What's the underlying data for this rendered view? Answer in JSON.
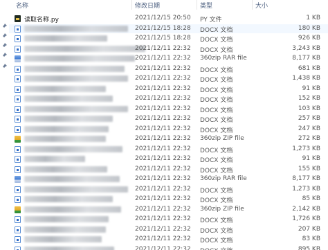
{
  "header": {
    "name": "名称",
    "date": "修改日期",
    "type": "类型",
    "size": "大小"
  },
  "files": [
    {
      "name": "读取名称.py",
      "date": "2021/12/15 20:50",
      "type": "PY 文件",
      "size": "1 KB",
      "icon": "python-file-icon"
    },
    {
      "name": "",
      "date": "2021/12/15 18:28",
      "type": "DOCX 文档",
      "size": "180 KB",
      "icon": "docx-file-icon"
    },
    {
      "name": "",
      "date": "2021/12/15 18:28",
      "type": "DOCX 文档",
      "size": "926 KB",
      "icon": "docx-file-icon"
    },
    {
      "name": "",
      "date": "2021/12/11 22:32",
      "type": "DOCX 文档",
      "size": "3,243 KB",
      "icon": "docx-file-icon"
    },
    {
      "name": "",
      "date": "2021/12/11 22:32",
      "type": "360zip RAR file",
      "size": "8,177 KB",
      "icon": "rar-archive-icon"
    },
    {
      "name": "",
      "date": "2021/12/11 22:32",
      "type": "DOCX 文档",
      "size": "681 KB",
      "icon": "docx-file-icon"
    },
    {
      "name": "",
      "date": "2021/12/11 22:32",
      "type": "DOCX 文档",
      "size": "1,438 KB",
      "icon": "docx-file-icon"
    },
    {
      "name": "",
      "date": "2021/12/11 22:32",
      "type": "DOCX 文档",
      "size": "91 KB",
      "icon": "docx-file-icon"
    },
    {
      "name": "",
      "date": "2021/12/11 22:32",
      "type": "DOCX 文档",
      "size": "152 KB",
      "icon": "docx-file-icon"
    },
    {
      "name": "",
      "date": "2021/12/11 22:32",
      "type": "DOCX 文档",
      "size": "103 KB",
      "icon": "docx-file-icon"
    },
    {
      "name": "",
      "date": "2021/12/11 22:32",
      "type": "DOCX 文档",
      "size": "257 KB",
      "icon": "docx-file-icon"
    },
    {
      "name": "",
      "date": "2021/12/11 22:32",
      "type": "DOCX 文档",
      "size": "247 KB",
      "icon": "docx-file-icon"
    },
    {
      "name": "",
      "date": "2021/12/11 22:32",
      "type": "360zip ZIP file",
      "size": "272 KB",
      "icon": "zip-archive-icon"
    },
    {
      "name": "",
      "date": "2021/12/11 22:32",
      "type": "DOCX 文档",
      "size": "1,273 KB",
      "icon": "docx-file-icon"
    },
    {
      "name": "",
      "date": "2021/12/11 22:32",
      "type": "DOCX 文档",
      "size": "91 KB",
      "icon": "docx-file-icon"
    },
    {
      "name": "",
      "date": "2021/12/11 22:32",
      "type": "DOCX 文档",
      "size": "155 KB",
      "icon": "docx-file-icon"
    },
    {
      "name": "",
      "date": "2021/12/11 22:32",
      "type": "360zip RAR file",
      "size": "8,177 KB",
      "icon": "rar-archive-icon"
    },
    {
      "name": "",
      "date": "2021/12/11 22:32",
      "type": "DOCX 文档",
      "size": "1,273 KB",
      "icon": "docx-file-icon"
    },
    {
      "name": "",
      "date": "2021/12/11 22:32",
      "type": "DOCX 文档",
      "size": "85 KB",
      "icon": "docx-file-icon"
    },
    {
      "name": "",
      "date": "2021/12/11 22:32",
      "type": "360zip ZIP file",
      "size": "2,142 KB",
      "icon": "zip-archive-icon"
    },
    {
      "name": "",
      "date": "2021/12/11 22:32",
      "type": "DOCX 文档",
      "size": "1,726 KB",
      "icon": "docx-file-icon"
    },
    {
      "name": "",
      "date": "2021/12/11 22:32",
      "type": "DOCX 文档",
      "size": "207 KB",
      "icon": "docx-file-icon"
    },
    {
      "name": "",
      "date": "2021/12/11 22:32",
      "type": "DOCX 文档",
      "size": "83 KB",
      "icon": "docx-file-icon"
    },
    {
      "name": "",
      "date": "2021/12/11 22:32",
      "type": "DOCX 文档",
      "size": "895 KB",
      "icon": "docx-file-icon"
    }
  ],
  "colors": {
    "header_text": "#4d6080",
    "selected_row": "#f2f8ff",
    "doc_blue": "#2b68c4"
  }
}
